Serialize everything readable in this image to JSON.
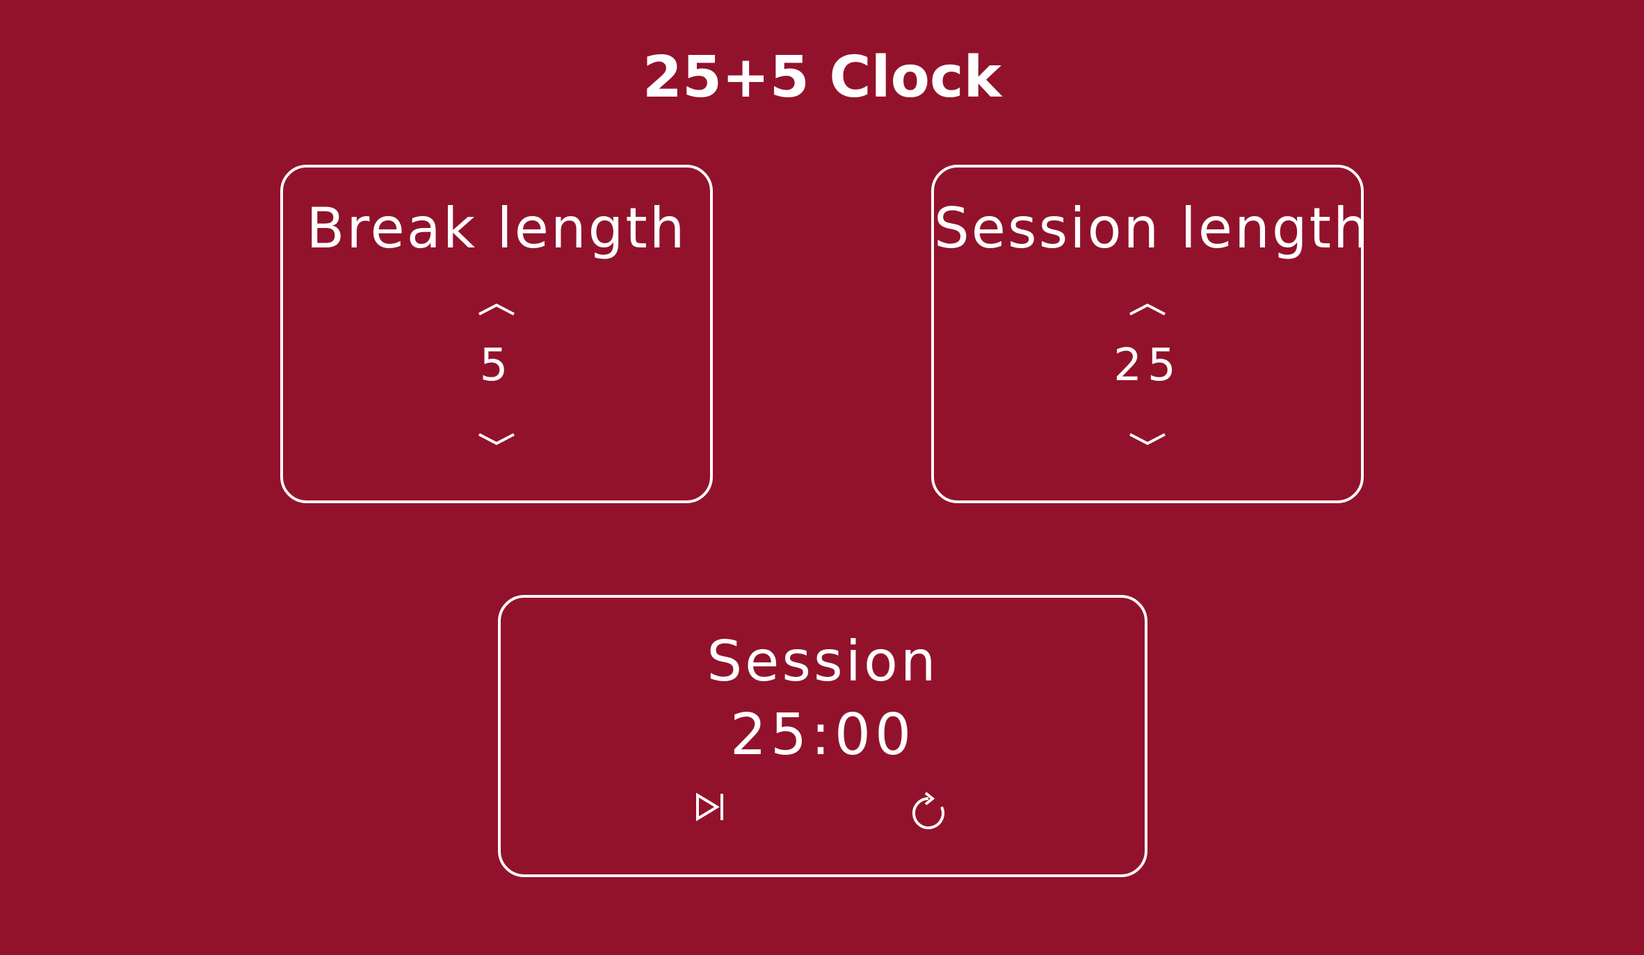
{
  "app": {
    "title": "25+5 Clock",
    "background_color": "#93122b",
    "foreground_color": "#ffffff"
  },
  "break_panel": {
    "label": "Break length",
    "value": "5",
    "increment_icon": "chevron-up-icon",
    "decrement_icon": "chevron-down-icon"
  },
  "session_panel": {
    "label": "Session length",
    "value": "25",
    "increment_icon": "chevron-up-icon",
    "decrement_icon": "chevron-down-icon"
  },
  "timer": {
    "label": "Session",
    "time_left": "25:00",
    "play_pause_icon": "play-pause-icon",
    "reset_icon": "refresh-icon"
  }
}
